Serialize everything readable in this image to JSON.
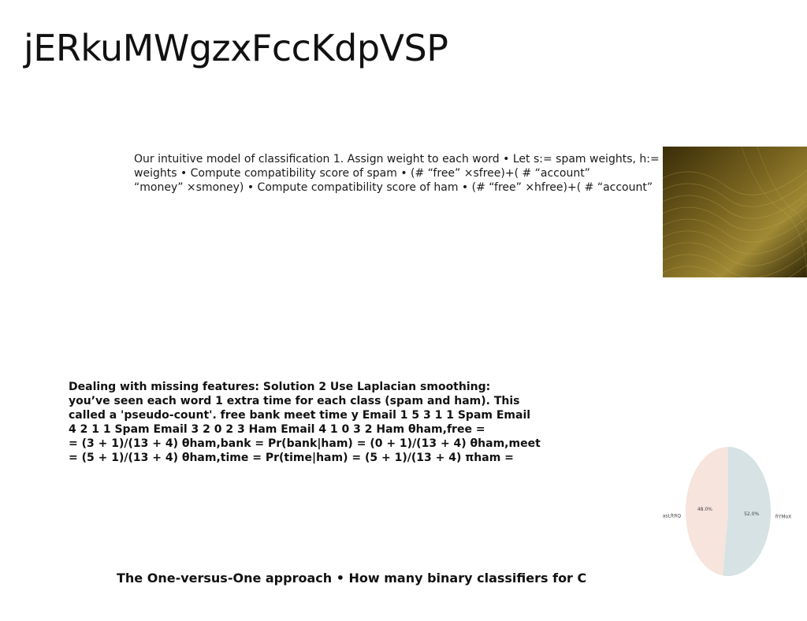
{
  "title": "jERkuMWgzxFccKdpVSP",
  "paragraph1_lines": [
    "Our intuitive model of classification 1. Assign weight to each word • Let s:= spam weights, h:=",
    "weights • Compute compatibility score of spam • (# “free” ×sfree)+( # “account”",
    "“money” ×smoney) • Compute compatibility score of ham • (# “free” ×hfree)+( # “account”"
  ],
  "paragraph2_lines": [
    "Dealing with missing features: Solution 2 Use Laplacian smoothing:",
    "you’ve seen each word 1 extra time for each class (spam and ham). This",
    "called a 'pseudo-count'. free bank meet time y Email 1 5 3 1 1 Spam Email",
    "4 2 1 1 Spam Email 3 2 0 2 3 Ham Email 4 1 0 3 2 Ham θham,free =",
    "= (3 + 1)/(13 + 4) θham,bank = Pr(bank|ham) = (0 + 1)/(13 + 4) θham,meet =",
    "= (5 + 1)/(13 + 4) θham,time = Pr(time|ham) = (5 + 1)/(13 + 4) πham ="
  ],
  "paragraph3": "The One-versus-One approach • How many binary classifiers for C",
  "image": {
    "description_icon": "photo-wave-texture",
    "tone": "#6b5716"
  },
  "chart_data": {
    "type": "pie",
    "slices": [
      {
        "label": "fiYMoX",
        "value": 52.0,
        "pct_label": "52.0%",
        "color": "#d6e2e3"
      },
      {
        "label": "asLftRQ",
        "value": 48.0,
        "pct_label": "48.0%",
        "color": "#f6e4dd"
      }
    ]
  }
}
